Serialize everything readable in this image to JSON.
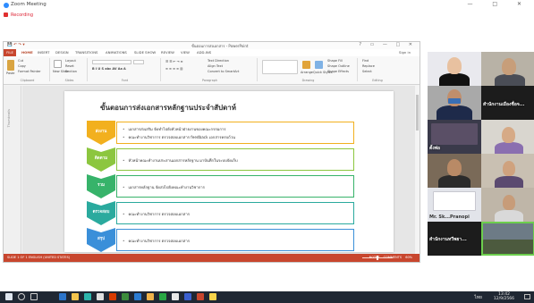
{
  "zoom": {
    "title": "Zoom Meeting",
    "recording": "Recording",
    "window_buttons": "— □ ✕"
  },
  "ppt": {
    "doc_title": "ขั้นตอนการส่งเอกสาร - PowerPoint",
    "quick_access": "💾 ↶ ↷ ▾",
    "window_buttons": "? ▭ — □ ✕",
    "signin": "Sign in",
    "tabs": [
      "FILE",
      "HOME",
      "INSERT",
      "DESIGN",
      "TRANSITIONS",
      "ANIMATIONS",
      "SLIDE SHOW",
      "REVIEW",
      "VIEW",
      "ADD-INS"
    ],
    "ribbon": {
      "cut": "Cut",
      "copy": "Copy",
      "format_painter": "Format Painter",
      "paste": "Paste",
      "new_slide": "New Slide",
      "layout": "Layout",
      "reset": "Reset",
      "section": "Section",
      "text_direction": "Text Direction",
      "align_text": "Align Text",
      "convert_smartart": "Convert to SmartArt",
      "arrange": "Arrange",
      "quick_styles": "Quick Styles",
      "shape_fill": "Shape Fill",
      "shape_outline": "Shape Outline",
      "shape_effects": "Shape Effects",
      "find": "Find",
      "replace": "Replace",
      "select": "Select",
      "groups": [
        "Clipboard",
        "Slides",
        "Font",
        "Paragraph",
        "Drawing",
        "Editing"
      ]
    },
    "thumbnails_label": "Thumbnails",
    "status_left": "SLIDE 1 OF 1    ENGLISH (UNITED STATES)",
    "status_right": "NOTES  COMMENTS",
    "zoom_pct": "60%"
  },
  "slide": {
    "title": "ขั้นตอนการส่งเอกสารหลักฐานประจำสัปดาห์",
    "steps": [
      {
        "label": "ส่งงาน",
        "color": "#f2b01e",
        "items": [
          "เอกสารส่งเสริม จัดทำไปยังหัวหน้าฝ่ายงานของคณะกรรมการ",
          "คณะทำงานวิชาการ ตรวจสอบเอกสาร feedback เอกสารครบถ้วน"
        ]
      },
      {
        "label": "ติดตาม",
        "color": "#8cc63f",
        "items": [
          "หัวหน้าคณะทำงานประสานเอกสารหลักฐาน มาบันทึกในระบบจัดเก็บ"
        ]
      },
      {
        "label": "รวม",
        "color": "#37b36a",
        "items": [
          "เอกสารหลักฐาน จัดส่งไปยังคณะทำงานวิชาการ"
        ]
      },
      {
        "label": "ตรวจสอบ",
        "color": "#2aaa9e",
        "items": [
          "คณะทำงานวิชาการ ตรวจสอบเอกสาร"
        ]
      },
      {
        "label": "สรุป",
        "color": "#3a8fd9",
        "items": [
          "คณะทำงานวิชาการ ตรวจสอบเอกสาร"
        ]
      }
    ]
  },
  "participants": [
    {
      "name": ""
    },
    {
      "name": ""
    },
    {
      "name": "สำนักงานเมืองชื่อจ..."
    },
    {
      "name": ""
    },
    {
      "name": ""
    },
    {
      "name": ""
    },
    {
      "name": "ตั้งพ่อ"
    },
    {
      "name": ""
    },
    {
      "name": "Mr. Sk...Pranopi"
    },
    {
      "name": ""
    },
    {
      "name": "สำนักงานทวีพยา..."
    },
    {
      "name": ""
    }
  ],
  "taskbar": {
    "lang": "ไทย",
    "time": "13:42",
    "date": "12/9/2566"
  }
}
